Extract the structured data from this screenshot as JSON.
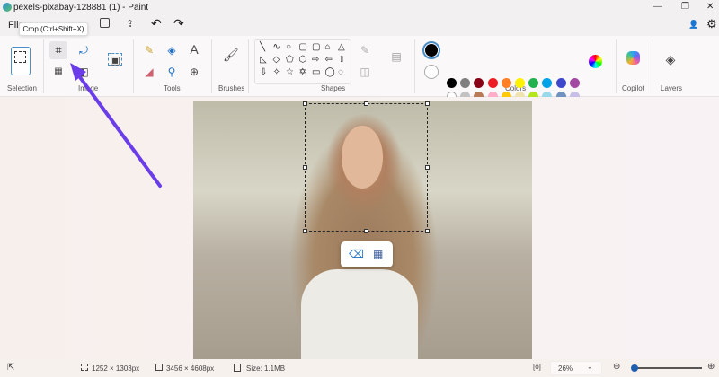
{
  "window": {
    "title": "pexels-pixabay-128881 (1) - Paint",
    "minimize": "—",
    "restore": "❐",
    "close": "✕"
  },
  "menu": {
    "file": "File",
    "save_icon": "save-icon",
    "share_icon": "share-icon",
    "undo": "↶",
    "redo": "↷"
  },
  "tooltip": "Crop (Ctrl+Shift+X)",
  "ribbon": {
    "groups": {
      "selection": "Selection",
      "image": "Image",
      "tools": "Tools",
      "brushes": "Brushes",
      "shapes": "Shapes",
      "colors": "Colors",
      "copilot": "Copilot",
      "layers": "Layers"
    },
    "shapes": [
      "╲",
      "∿",
      "○",
      "▢",
      "▢",
      "⌂",
      "△",
      "◺",
      "◇",
      "⬠",
      "⬡",
      "⇨",
      "⇦",
      "⇧",
      "⇩",
      "✧",
      "☆",
      "✡",
      "▭",
      "◯",
      "◌"
    ],
    "colors_row1": [
      "#000000",
      "#7f7f7f",
      "#880015",
      "#ed1c24",
      "#ff7f27",
      "#fff200",
      "#22b14c",
      "#00a2e8",
      "#3f48cc",
      "#a349a4"
    ],
    "colors_row2": [
      "#ffffff",
      "#c3c3c3",
      "#b97a57",
      "#ffaec9",
      "#ffc90e",
      "#efe4b0",
      "#b5e61d",
      "#99d9ea",
      "#7092be",
      "#c8bfe7"
    ],
    "primary_color": "#000000",
    "secondary_color": "#ffffff"
  },
  "annotation": {
    "arrow_color": "#6a3de8"
  },
  "status": {
    "selection_size": "1252 × 1303px",
    "canvas_size": "3456 × 4608px",
    "file_size": "Size: 1.1MB",
    "zoom": "26%",
    "zoom_level_percent": 26
  }
}
